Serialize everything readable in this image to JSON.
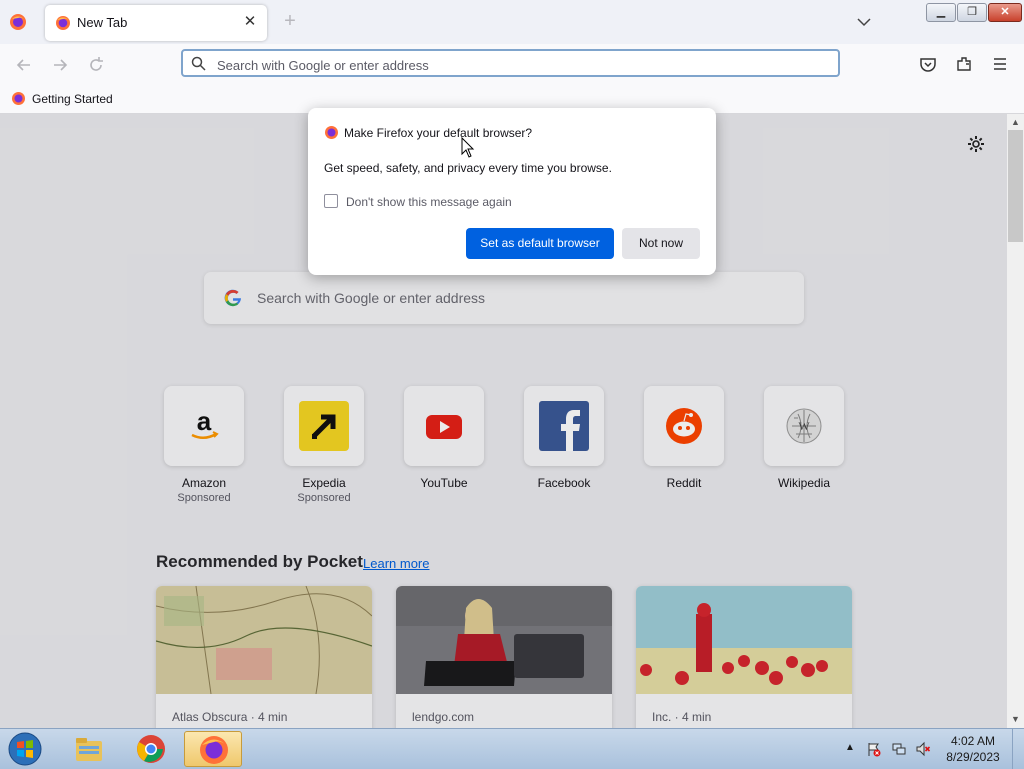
{
  "browser": {
    "tab": {
      "title": "New Tab"
    },
    "urlbar": {
      "placeholder": "Search with Google or enter address"
    },
    "bookmarks": [
      {
        "label": "Getting Started"
      }
    ]
  },
  "newtab": {
    "search": {
      "placeholder": "Search with Google or enter address"
    },
    "top_sites": [
      {
        "title": "Amazon",
        "sub": "Sponsored",
        "icon": "amazon-icon"
      },
      {
        "title": "Expedia",
        "sub": "Sponsored",
        "icon": "expedia-icon"
      },
      {
        "title": "YouTube",
        "sub": "",
        "icon": "youtube-icon"
      },
      {
        "title": "Facebook",
        "sub": "",
        "icon": "facebook-icon"
      },
      {
        "title": "Reddit",
        "sub": "",
        "icon": "reddit-icon"
      },
      {
        "title": "Wikipedia",
        "sub": "",
        "icon": "wikipedia-icon"
      }
    ],
    "pocket": {
      "heading": "Recommended by Pocket",
      "learn_more": "Learn more",
      "cards": [
        {
          "source": "Atlas Obscura · 4 min"
        },
        {
          "source": "lendgo.com"
        },
        {
          "source": "Inc. · 4 min"
        }
      ]
    }
  },
  "dialog": {
    "title": "Make Firefox your default browser?",
    "body": "Get speed, safety, and privacy every time you browse.",
    "checkbox_label": "Don't show this message again",
    "checkbox_checked": false,
    "primary_button": "Set as default browser",
    "secondary_button": "Not now"
  },
  "taskbar": {
    "time": "4:02 AM",
    "date": "8/29/2023"
  },
  "colors": {
    "accent": "#0061e0",
    "urlbar_focus": "#7fa4cc",
    "link": "#0060df"
  }
}
